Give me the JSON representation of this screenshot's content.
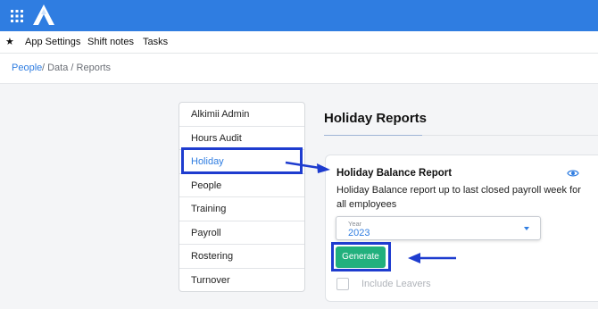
{
  "topbar": {
    "grid_icon": "apps-grid-icon",
    "logo_icon": "alkimii-logo-icon",
    "background": "#2f7de1"
  },
  "subnav": {
    "star_icon": "star-icon",
    "items": [
      {
        "label": "App Settings"
      },
      {
        "label": "Shift notes"
      },
      {
        "label": "Tasks"
      }
    ]
  },
  "breadcrumb": {
    "link": "People",
    "rest": "/ Data / Reports"
  },
  "sidebar": {
    "items": [
      {
        "label": "Alkimii Admin"
      },
      {
        "label": "Hours Audit"
      },
      {
        "label": "Holiday",
        "active": true
      },
      {
        "label": "People"
      },
      {
        "label": "Training"
      },
      {
        "label": "Payroll"
      },
      {
        "label": "Rostering"
      },
      {
        "label": "Turnover"
      }
    ]
  },
  "main": {
    "title": "Holiday Reports",
    "card": {
      "title": "Holiday Balance Report",
      "description": "Holiday Balance report up to last closed payroll week for all employees",
      "eye_icon": "eye-icon",
      "year_label": "Year",
      "year_value": "2023",
      "generate_label": "Generate",
      "include_leavers_label": "Include Leavers",
      "include_leavers_checked": false
    }
  },
  "annotations": {
    "highlight_color": "#1e3ccf",
    "accent": "#22b07d"
  }
}
